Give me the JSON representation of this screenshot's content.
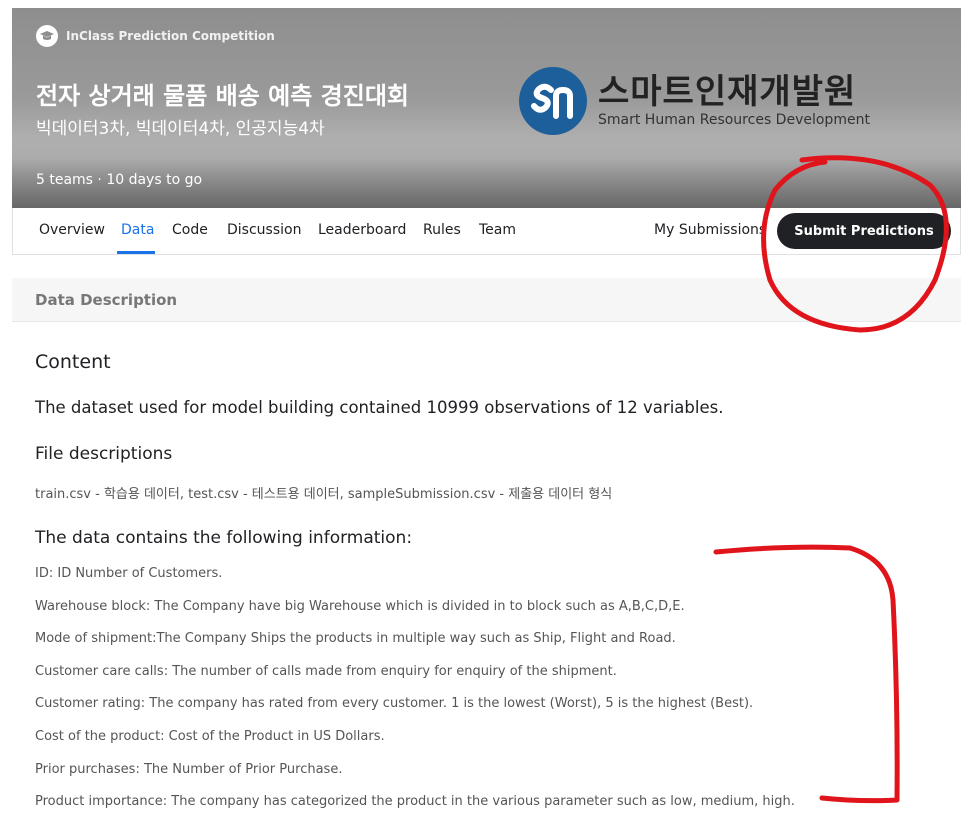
{
  "header": {
    "badge": "InClass Prediction Competition",
    "title": "전자 상거래 물품 배송 예측 경진대회",
    "subtitle": "빅데이터3차, 빅데이터4차, 인공지능4차",
    "meta": "5 teams · 10 days to go",
    "logo": {
      "ko": "스마트인재개발원",
      "en": "Smart Human Resources Development",
      "brand_color": "#1d5f9b"
    }
  },
  "tabs": [
    "Overview",
    "Data",
    "Code",
    "Discussion",
    "Leaderboard",
    "Rules",
    "Team"
  ],
  "active_tab": "Data",
  "actions": {
    "my_submissions": "My Submissions",
    "submit": "Submit Predictions"
  },
  "section": {
    "title": "Data Description"
  },
  "content": {
    "heading": "Content",
    "intro": "The dataset used for model building contained 10999 observations of 12 variables.",
    "files_heading": "File descriptions",
    "files_desc": "train.csv - 학습용 데이터, test.csv - 테스트용 데이터, sampleSubmission.csv - 제출용 데이터 형식",
    "info_heading": "The data contains the following information:",
    "info_items": [
      "ID: ID Number of Customers.",
      "Warehouse block: The Company have big Warehouse which is divided in to block such as A,B,C,D,E.",
      "Mode of shipment:The Company Ships the products in multiple way such as Ship, Flight and Road.",
      "Customer care calls: The number of calls made from enquiry for enquiry of the shipment.",
      "Customer rating: The company has rated from every customer. 1 is the lowest (Worst), 5 is the highest (Best).",
      "Cost of the product: Cost of the Product in US Dollars.",
      "Prior purchases: The Number of Prior Purchase.",
      "Product importance: The company has categorized the product in the various parameter such as low, medium, high."
    ]
  },
  "colors": {
    "accent": "#1a73e8",
    "button_bg": "#202124",
    "annotation": "#e0141b"
  },
  "icons": {
    "badge": "graduation-cap-icon"
  }
}
